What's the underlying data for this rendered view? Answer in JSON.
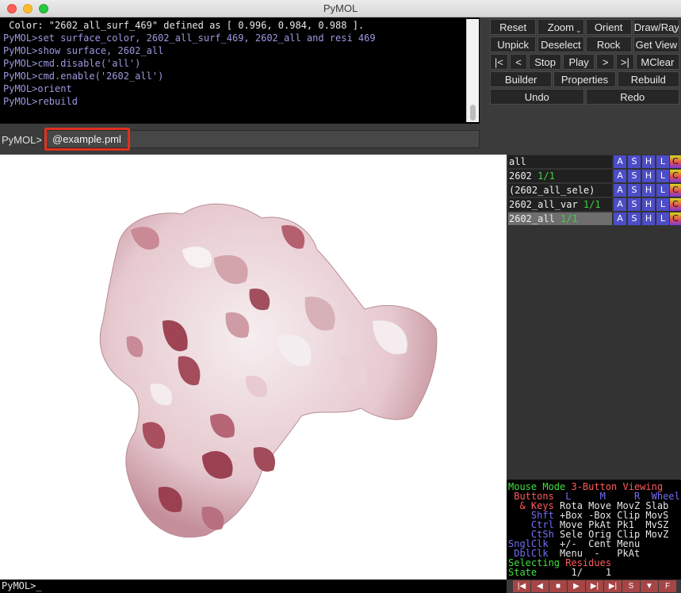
{
  "window": {
    "title": "PyMOL"
  },
  "console": {
    "lines": [
      " Color: \"2602_all_surf_469\" defined as [ 0.996, 0.984, 0.988 ].",
      "PyMOL>set surface_color, 2602_all_surf_469, 2602_all and resi 469",
      "PyMOL>show surface, 2602_all",
      "PyMOL>cmd.disable('all')",
      "PyMOL>cmd.enable('2602_all')",
      "PyMOL>orient",
      "PyMOL>rebuild"
    ]
  },
  "command": {
    "label": "PyMOL>",
    "value": "@example.pml"
  },
  "buttons": {
    "row1": [
      "Reset",
      "Zoom",
      "Orient",
      "Draw/Ray"
    ],
    "row2": [
      "Unpick",
      "Deselect",
      "Rock",
      "Get View"
    ],
    "row3": [
      "|<",
      "<",
      "Stop",
      "Play",
      ">",
      ">|",
      "MClear"
    ],
    "row4": [
      "Builder",
      "Properties",
      "Rebuild"
    ],
    "row5": [
      "Undo",
      "Redo"
    ]
  },
  "objects": [
    {
      "name": "all",
      "state": ""
    },
    {
      "name": "2602 ",
      "state": "1/1"
    },
    {
      "name": "(2602_all_sele)",
      "state": ""
    },
    {
      "name": "2602_all_var ",
      "state": "1/1"
    },
    {
      "name": "2602_all ",
      "state": "1/1"
    }
  ],
  "object_buttons": {
    "a": "A",
    "s": "S",
    "h": "H",
    "l": "L",
    "c": "C"
  },
  "mouse_help": {
    "l1a": "Mouse Mode ",
    "l1b": "3-Button Viewing",
    "l2a": " Buttons ",
    "l2b": " L     M     R  Wheel",
    "l3a": "  & Keys ",
    "l3b": "Rota Move MovZ Slab",
    "l4a": "    Shft ",
    "l4b": "+Box -Box Clip MovS",
    "l5a": "    Ctrl ",
    "l5b": "Move PkAt Pk1  MvSZ",
    "l6a": "    CtSh ",
    "l6b": "Sele Orig Clip MovZ",
    "l7a": "SnglClk  ",
    "l7b": "+/-  Cent Menu",
    "l8a": " DblClk  ",
    "l8b": "Menu  -   PkAt",
    "l9a": "Selecting ",
    "l9b": "Residues",
    "l10a": "State  ",
    "l10b": "    1/    1"
  },
  "bottom": {
    "prompt": "PyMOL>_"
  },
  "playback": [
    "|◀",
    "◀",
    "■",
    "▶",
    "▶|",
    "▶|",
    "S",
    "▼",
    "F"
  ],
  "colors": {
    "surface_light": "#f3eaec",
    "surface_mid": "#d9a9b2",
    "surface_dark": "#a9505f",
    "highlight": "#e0301e"
  }
}
